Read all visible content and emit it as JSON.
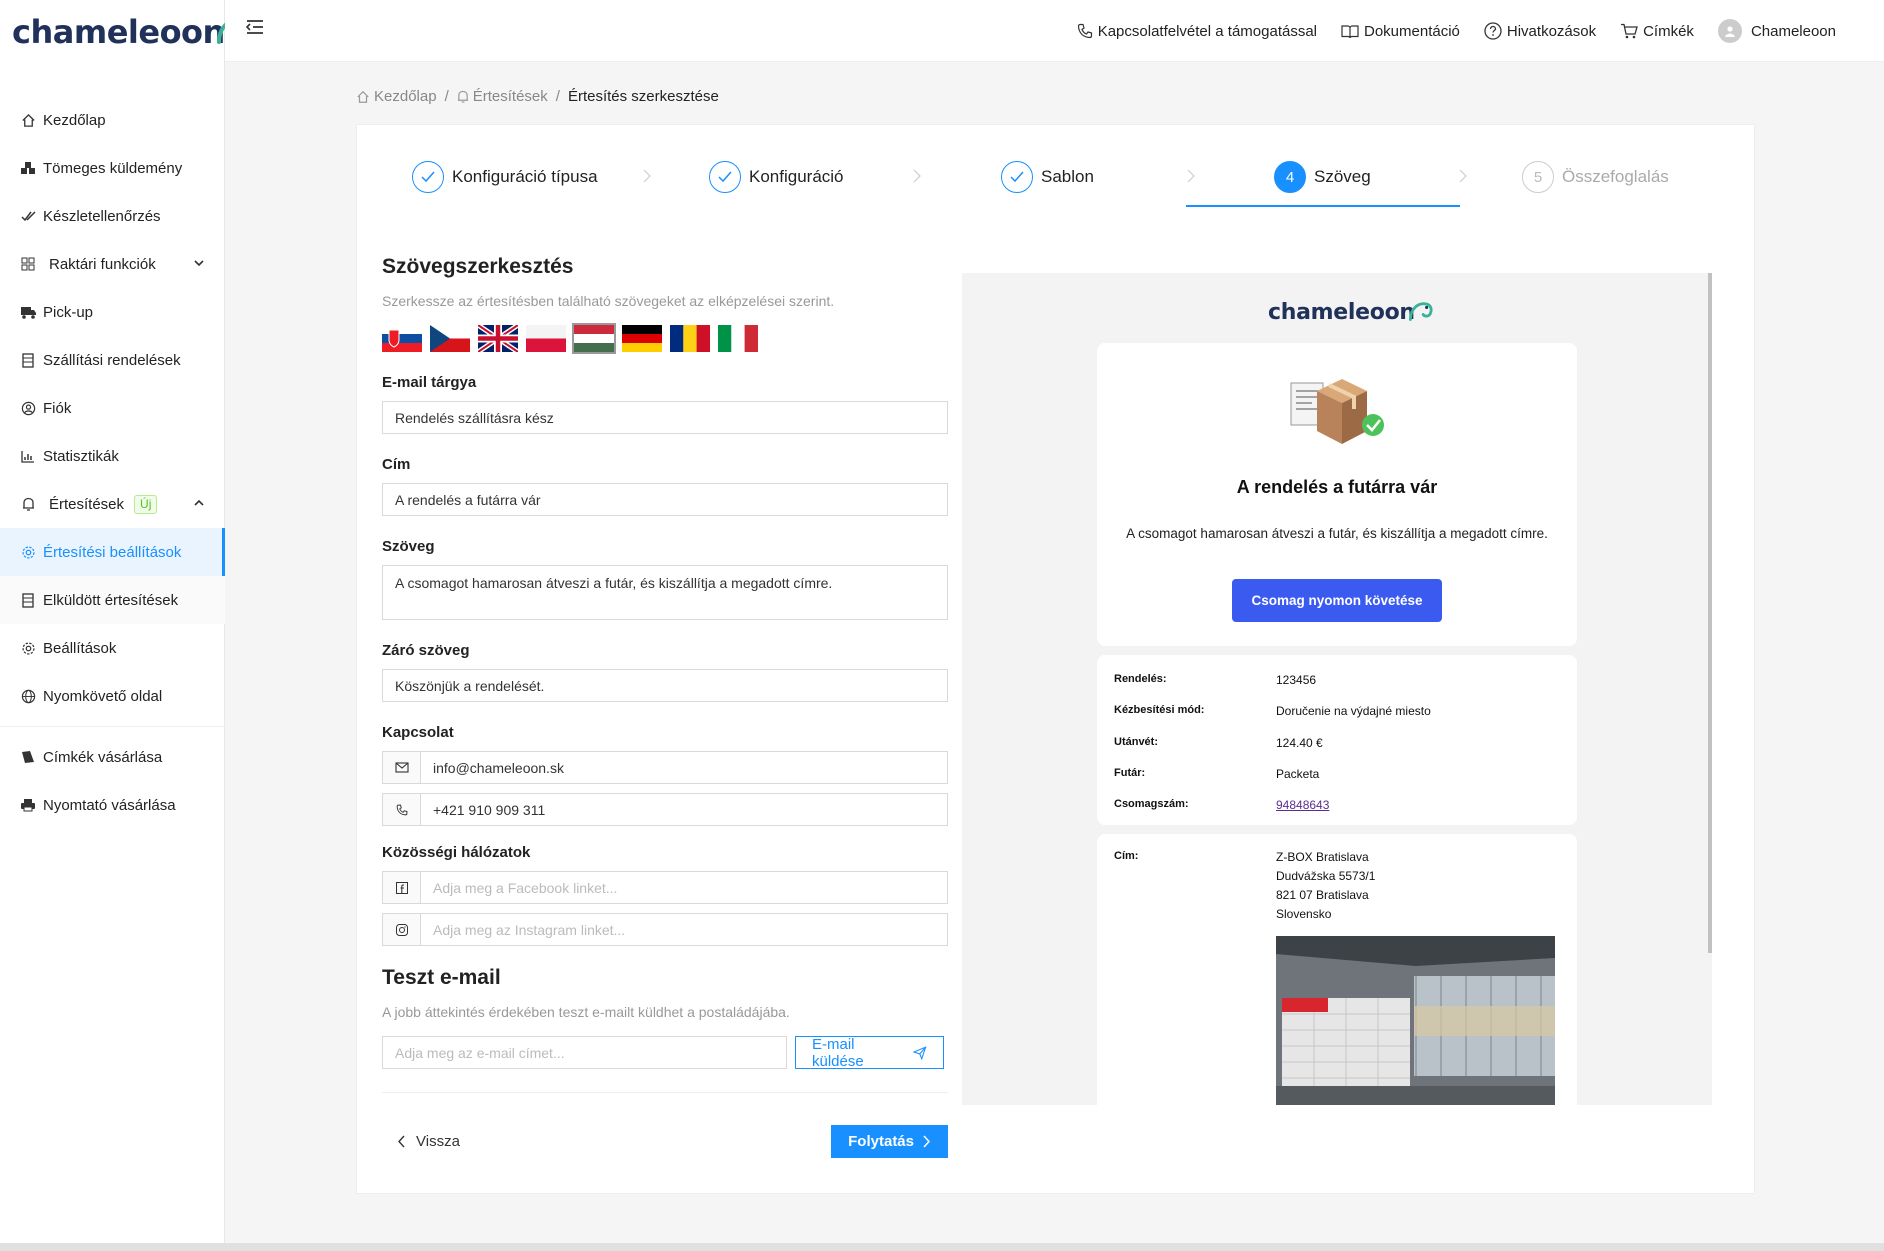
{
  "brand": {
    "name": "chameleoon",
    "accent": "#1890ff",
    "logo_teal": "#3ab29a",
    "logo_navy": "#20315a"
  },
  "sidebar": {
    "items": [
      {
        "label": "Kezdőlap",
        "icon": "home-icon"
      },
      {
        "label": "Tömeges küldemény",
        "icon": "boxes-icon"
      },
      {
        "label": "Készletellenőrzés",
        "icon": "check-double-icon"
      },
      {
        "label": "Raktári funkciók",
        "icon": "grid-icon"
      },
      {
        "label": "Pick-up",
        "icon": "truck-icon"
      },
      {
        "label": "Szállítási rendelések",
        "icon": "list-icon"
      },
      {
        "label": "Fiók",
        "icon": "user-circle-icon"
      },
      {
        "label": "Statisztikák",
        "icon": "chart-icon"
      },
      {
        "label": "Értesítések",
        "icon": "bell-icon",
        "badge": "Új"
      },
      {
        "label": "Értesítési beállítások",
        "icon": "gear-icon"
      },
      {
        "label": "Elküldött értesítések",
        "icon": "list-icon"
      },
      {
        "label": "Beállítások",
        "icon": "gear-icon"
      },
      {
        "label": "Nyomkövető oldal",
        "icon": "globe-icon"
      },
      {
        "label": "Címkék vásárlása",
        "icon": "label-icon"
      },
      {
        "label": "Nyomtató vásárlása",
        "icon": "printer-icon"
      }
    ]
  },
  "topbar": {
    "links": [
      {
        "label": "Kapcsolatfelvétel a támogatással",
        "icon": "phone-icon"
      },
      {
        "label": "Dokumentáció",
        "icon": "book-icon"
      },
      {
        "label": "Hivatkozások",
        "icon": "question-icon"
      },
      {
        "label": "Címkék",
        "icon": "cart-icon"
      }
    ],
    "user": "Chameleoon"
  },
  "breadcrumb": [
    "Kezdőlap",
    "Értesítések",
    "Értesítés szerkesztése"
  ],
  "steps": [
    {
      "label": "Konfiguráció típusa",
      "state": "done"
    },
    {
      "label": "Konfiguráció",
      "state": "done"
    },
    {
      "label": "Sablon",
      "state": "done"
    },
    {
      "label": "Szöveg",
      "state": "current",
      "num": "4"
    },
    {
      "label": "Összefoglalás",
      "state": "wait",
      "num": "5"
    }
  ],
  "form": {
    "title": "Szövegszerkesztés",
    "desc": "Szerkessze az értesítésben található szövegeket az elképzelései szerint.",
    "flags": [
      "sk",
      "cz",
      "gb",
      "pl",
      "hu",
      "de",
      "ro",
      "it"
    ],
    "subject_label": "E-mail tárgya",
    "subject": "Rendelés szállításra kész",
    "title_label": "Cím",
    "title_value": "A rendelés a futárra vár",
    "text_label": "Szöveg",
    "text_value": "A csomagot hamarosan átveszi a futár, és kiszállítja a megadott címre.",
    "closing_label": "Záró szöveg",
    "closing": "Köszönjük a rendelését.",
    "contact_label": "Kapcsolat",
    "email": "info@chameleoon.sk",
    "phone": "+421 910 909 311",
    "social_label": "Közösségi hálózatok",
    "facebook_ph": "Adja meg a Facebook linket...",
    "instagram_ph": "Adja meg az Instagram linket...",
    "test_title": "Teszt e-mail",
    "test_desc": "A jobb áttekintés érdekében teszt e-mailt küldhet a postaládájába.",
    "test_ph": "Adja meg az e-mail címet...",
    "send_label": "E-mail küldése",
    "back_label": "Vissza",
    "next_label": "Folytatás"
  },
  "preview": {
    "logo": "chameleoon",
    "heading": "A rendelés a futárra vár",
    "text": "A csomagot hamarosan átveszi a futár, és kiszállítja a megadott címre.",
    "button": "Csomag nyomon követése",
    "rows": [
      {
        "k": "Rendelés:",
        "v": "123456"
      },
      {
        "k": "Kézbesítési mód:",
        "v": "Doručenie na výdajné miesto"
      },
      {
        "k": "Utánvét:",
        "v": "124.40 €"
      },
      {
        "k": "Futár:",
        "v": "Packeta"
      },
      {
        "k": "Csomagszám:",
        "v": "94848643"
      }
    ],
    "addr_label": "Cím:",
    "addr": [
      "Z-BOX Bratislava",
      "Dudvážska 5573/1",
      "821 07 Bratislava",
      "Slovensko"
    ]
  }
}
